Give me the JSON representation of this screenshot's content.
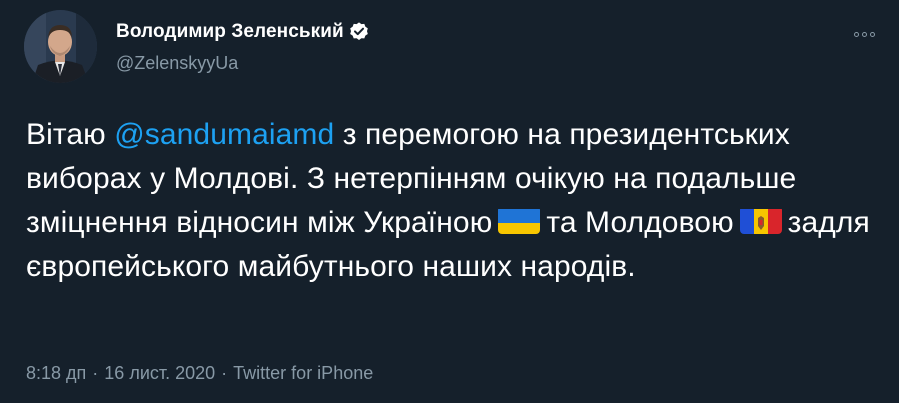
{
  "author": {
    "name": "Володимир Зеленський",
    "handle": "@ZelenskyyUa",
    "verified": true,
    "avatar_icon": "avatar-photo"
  },
  "menu": {
    "icon": "more-options-icon"
  },
  "tweet": {
    "segment_1": "Вітаю ",
    "mention": "@sandumaiamd",
    "segment_2": " з перемогою на президентських виборах у Молдові. З нетерпінням очікую на подальше зміцнення відносин між Україною",
    "flag_1": "ukraine-flag-icon",
    "segment_3": "та Молдовою",
    "flag_2": "moldova-flag-icon",
    "segment_4": "задля європейського майбутнього наших народів."
  },
  "meta": {
    "time": "8:18 дп",
    "separator": "·",
    "date": "16 лист. 2020",
    "source": "Twitter for iPhone"
  },
  "colors": {
    "background": "#15202b",
    "text": "#ffffff",
    "secondary": "#8899a6",
    "accent": "#1da1f2"
  }
}
